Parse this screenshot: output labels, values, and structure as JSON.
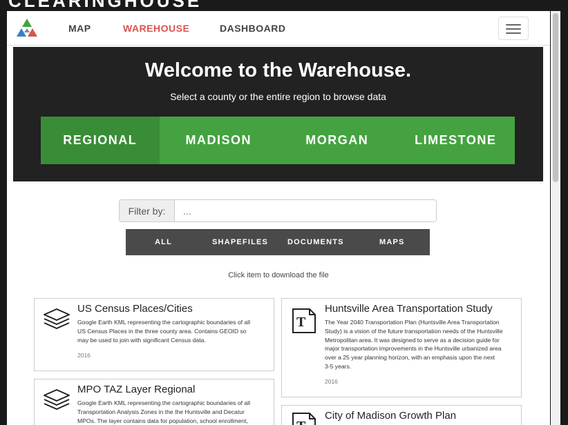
{
  "app": {
    "outer_title": "CLEARINGHOUSE"
  },
  "nav": {
    "links": [
      "MAP",
      "WAREHOUSE",
      "DASHBOARD"
    ],
    "active": "WAREHOUSE",
    "menu_icon": "hamburger-icon",
    "active_color": "#d9534f"
  },
  "hero": {
    "title": "Welcome to the Warehouse.",
    "subtitle": "Select a county or the entire region to browse data",
    "counties": [
      "REGIONAL",
      "MADISON",
      "MORGAN",
      "LIMESTONE"
    ],
    "selected_county": "REGIONAL",
    "accent": "#44a340"
  },
  "filter": {
    "label": "Filter by:",
    "placeholder": "...",
    "value": ""
  },
  "type_tabs": [
    "ALL",
    "SHAPEFILES",
    "DOCUMENTS",
    "MAPS"
  ],
  "hint": "Click item to download the file",
  "items": [
    {
      "title": "US Census Places/Cities",
      "icon": "layers-icon",
      "description_lines": [
        "Google Earth KML representing the cartographic boundaries of all",
        "US Census Places in the three county area. Contains GEOID so",
        "may be used to join with significant Census data."
      ],
      "year": "2016"
    },
    {
      "title": "Huntsville Area Transportation Study",
      "icon": "document-icon",
      "description_lines": [
        "The Year 2040 Transportation Plan (Huntsville Area Transportation",
        "Study) is a vision of the future transportation needs of the Huntsville",
        "Metropolitan area. It was designed to serve as a decision guide for",
        "major transportation improvements in the Huntsville urbanized area",
        "over a 25 year planning horizon, with an emphasis upon the next",
        "3-5 years."
      ],
      "year": "2016"
    },
    {
      "title": "MPO TAZ Layer Regional",
      "icon": "layers-icon",
      "description_lines": [
        "Google Earth KML representing the cartographic boundaries of all",
        "Transportation Analysis Zones in the the Huntsville and Decatur",
        "MPOs. The layer contains data for population, school enrollment,"
      ],
      "year": ""
    },
    {
      "title": "City of Madison Growth Plan",
      "icon": "document-icon",
      "description_lines": [],
      "year": ""
    }
  ]
}
